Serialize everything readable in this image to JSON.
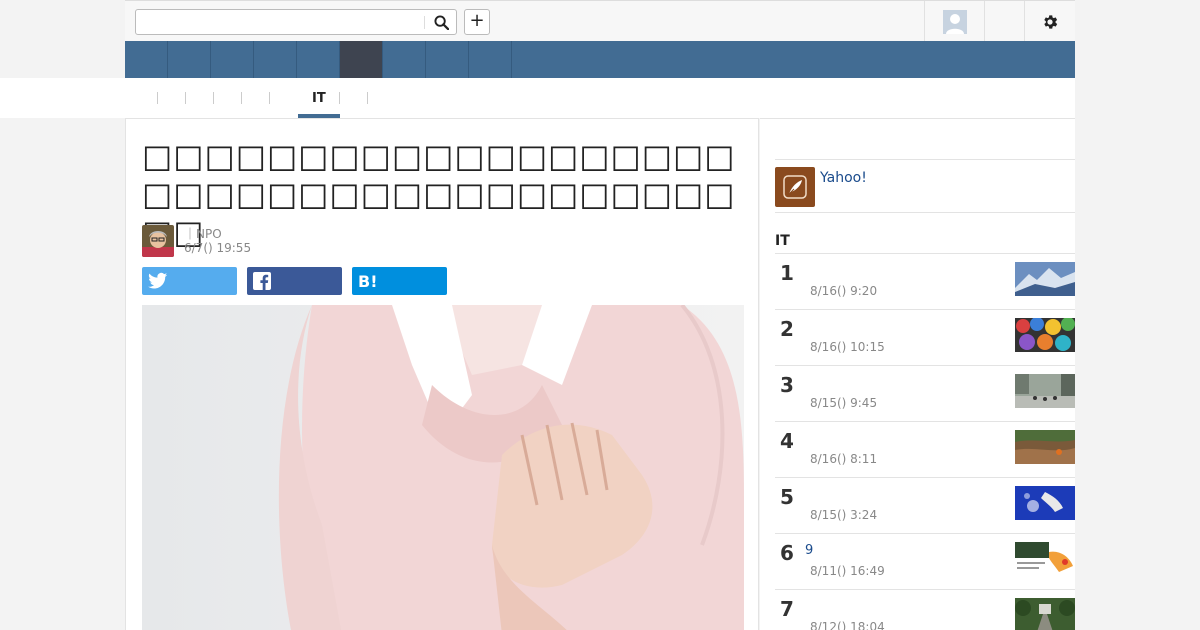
{
  "header": {
    "search_placeholder": "",
    "search_icon": "search-icon",
    "plus_label": "+",
    "avatar_icon": "user-avatar-icon",
    "gear_icon": "gear-icon"
  },
  "nav": {
    "items": [
      "",
      "",
      "",
      "",
      "",
      "",
      "",
      "",
      ""
    ],
    "active_index": 5
  },
  "subnav": {
    "items": [
      "",
      "",
      "",
      "",
      "",
      "",
      "IT",
      ""
    ],
    "active_index": 6
  },
  "article": {
    "title": "□□□□□□□□□□□□□□□□□□□□□□□□□□□□□□□□□□□□□□□□",
    "author_line": "｜NPO",
    "date": "6/7() 19:55",
    "share": {
      "twitter_icon": "twitter-icon",
      "facebook_icon": "facebook-icon",
      "hatena_label": "B!"
    }
  },
  "sidebar": {
    "promo_link": "Yahoo!",
    "ranking_title": "IT",
    "ranking": [
      {
        "rank": "1",
        "title": "",
        "date": "8/16() 9:20"
      },
      {
        "rank": "2",
        "title": "",
        "date": "8/16() 10:15"
      },
      {
        "rank": "3",
        "title": "",
        "date": "8/15() 9:45"
      },
      {
        "rank": "4",
        "title": "",
        "date": "8/16() 8:11"
      },
      {
        "rank": "5",
        "title": "",
        "date": "8/15() 3:24"
      },
      {
        "rank": "6",
        "title": "9",
        "date": "8/11() 16:49"
      },
      {
        "rank": "7",
        "title": "",
        "date": "8/12() 18:04"
      }
    ]
  },
  "colors": {
    "nav_blue": "#426c93",
    "nav_active": "#3e4450",
    "link": "#1a4b8c",
    "twitter": "#55acee",
    "facebook": "#3b5998",
    "hatena": "#008fde"
  }
}
